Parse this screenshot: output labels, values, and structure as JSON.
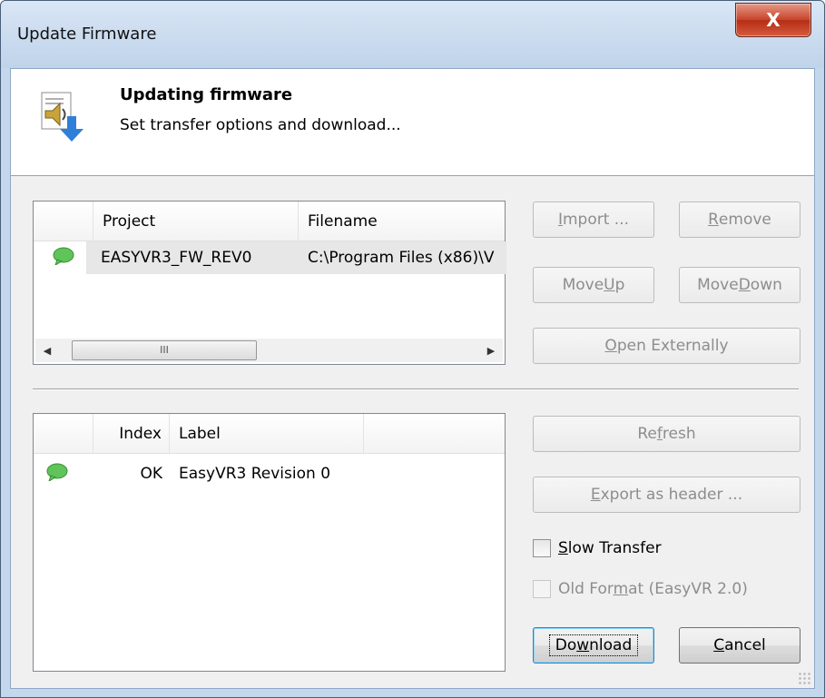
{
  "window": {
    "title": "Update Firmware",
    "close_glyph": "X"
  },
  "header": {
    "title": "Updating firmware",
    "subtitle": "Set transfer options and download..."
  },
  "projects": {
    "columns": [
      "Project",
      "Filename"
    ],
    "rows": [
      {
        "icon": "speech-bubble-green-icon",
        "project": "EASYVR3_FW_REV0",
        "filename": "C:\\Program Files (x86)\\V"
      }
    ],
    "scroll_left": "◀",
    "scroll_right": "▶",
    "scroll_grip": "III"
  },
  "project_buttons": {
    "import_pre": "",
    "import_u": "I",
    "import_post": "mport ...",
    "remove_pre": "",
    "remove_u": "R",
    "remove_post": "emove",
    "move_up_pre": "Move ",
    "move_up_u": "U",
    "move_up_post": "p",
    "move_down_pre": "Move ",
    "move_down_u": "D",
    "move_down_post": "own",
    "open_ext_pre": "",
    "open_ext_u": "O",
    "open_ext_post": "pen Externally"
  },
  "entries": {
    "columns": [
      "Index",
      "Label"
    ],
    "rows": [
      {
        "icon": "speech-bubble-green-icon",
        "index": "OK",
        "label": "EasyVR3 Revision 0"
      }
    ]
  },
  "entry_buttons": {
    "refresh_pre": "Re",
    "refresh_u": "f",
    "refresh_post": "resh",
    "export_pre": "",
    "export_u": "E",
    "export_post": "xport as header ..."
  },
  "options": {
    "slow_transfer_u": "S",
    "slow_transfer_post": "low Transfer",
    "slow_transfer_checked": false,
    "old_format_pre": "Old For",
    "old_format_u": "m",
    "old_format_post": "at (EasyVR 2.0)",
    "old_format_checked": false
  },
  "actions": {
    "download_pre": "Do",
    "download_u": "w",
    "download_post": "nload",
    "cancel_pre": "",
    "cancel_u": "C",
    "cancel_post": "ancel"
  },
  "colors": {
    "titlebar": "#c3d7ed",
    "close_button": "#c8432b",
    "bubble_green": "#5fc45a"
  }
}
